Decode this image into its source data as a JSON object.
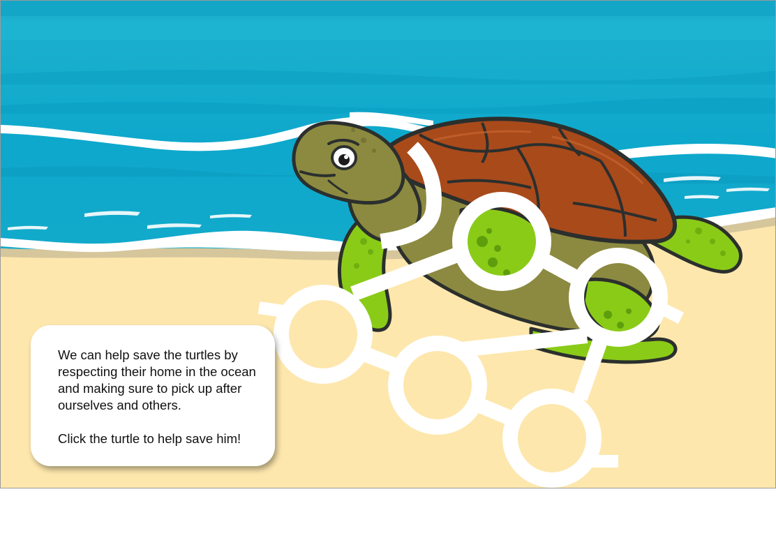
{
  "scene": {
    "colors": {
      "sky_top": "#1fb1ce",
      "ocean": "#12aacb",
      "ocean_dark": "#0892b8",
      "sand": "#fde7ad",
      "foam": "#ffffff",
      "shell": "#a94a1b",
      "turtle_skin": "#8c8a40",
      "flipper": "#8acb18",
      "outline": "#2b2f2d"
    },
    "icons": {
      "turtle": "sea-turtle-character",
      "rings": "plastic-six-pack-rings"
    }
  },
  "info_card": {
    "message": "We can help save the turtles by respecting their home in the ocean and making sure to pick up after ourselves and others.",
    "instruction": "Click the turtle to help save him!"
  }
}
